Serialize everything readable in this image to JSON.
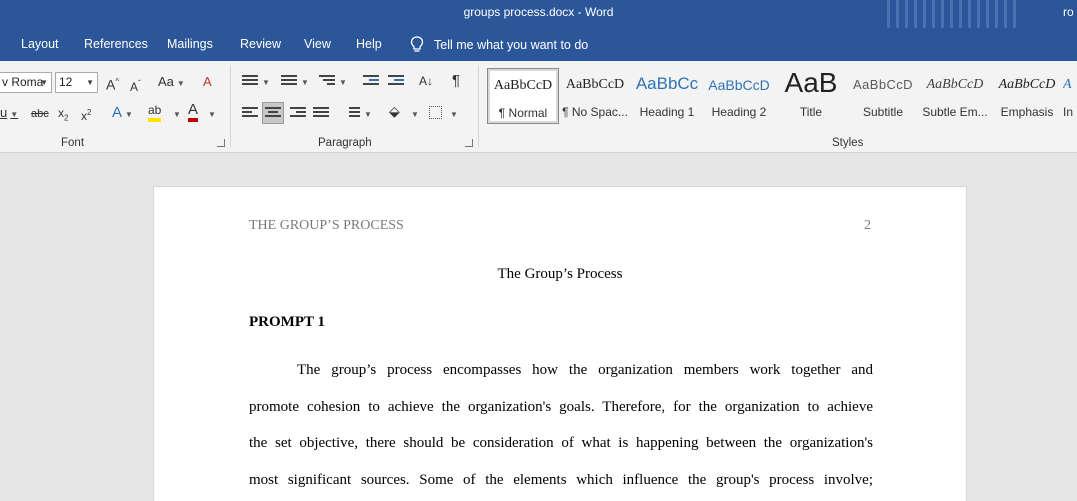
{
  "titlebar": {
    "document_title": "groups process.docx  -  Word",
    "user_fragment": "ro"
  },
  "tabs": [
    {
      "label": "Layout"
    },
    {
      "label": "References"
    },
    {
      "label": "Mailings"
    },
    {
      "label": "Review"
    },
    {
      "label": "View"
    },
    {
      "label": "Help"
    }
  ],
  "tell_me": "Tell me what you want to do",
  "ribbon": {
    "font": {
      "name": "v Roma",
      "size": "12",
      "group_label": "Font",
      "change_case": "Aa"
    },
    "paragraph": {
      "group_label": "Paragraph"
    },
    "styles": {
      "group_label": "Styles",
      "items": [
        {
          "preview": "AaBbCcD",
          "name": "¶ Normal"
        },
        {
          "preview": "AaBbCcD",
          "name": "¶ No Spac..."
        },
        {
          "preview": "AaBbCc",
          "name": "Heading 1"
        },
        {
          "preview": "AaBbCcD",
          "name": "Heading 2"
        },
        {
          "preview": "AaB",
          "name": "Title"
        },
        {
          "preview": "AaBbCcD",
          "name": "Subtitle"
        },
        {
          "preview": "AaBbCcD",
          "name": "Subtle Em..."
        },
        {
          "preview": "AaBbCcD",
          "name": "Emphasis"
        },
        {
          "preview": "A",
          "name": "In"
        }
      ]
    }
  },
  "document": {
    "running_head": "THE GROUP’S PROCESS",
    "page_number": "2",
    "title": "The Group’s Process",
    "heading": "PROMPT 1",
    "lines": [
      "The group’s process encompasses how the organization members work together and",
      "promote cohesion to achieve the organization's goals. Therefore, for the organization to achieve",
      "the set objective, there should be consideration of what is happening between the organization's",
      "most significant sources. Some of the elements which influence the group's process involve;"
    ]
  },
  "colors": {
    "word_blue": "#2b579a",
    "ribbon_bg": "#f3f3f3",
    "canvas_bg": "#e6e6e6",
    "heading_blue": "#2e74b5"
  }
}
